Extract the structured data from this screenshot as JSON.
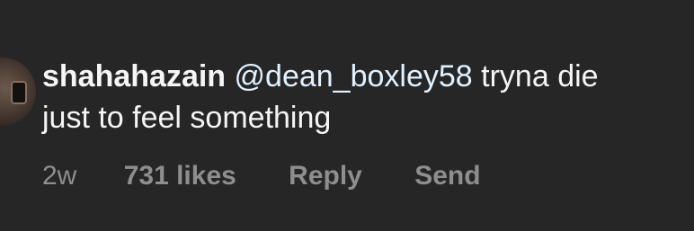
{
  "comment": {
    "username": "shahahazain",
    "mention": "@dean_boxley58",
    "text_line1": "tryna die",
    "text_line2": "just to feel something",
    "timestamp": "2w",
    "likes": "731 likes",
    "reply_label": "Reply",
    "send_label": "Send"
  },
  "colors": {
    "background": "#262626",
    "text": "#f5f5f5",
    "mention": "#e0f1ff",
    "meta": "#8e8e8e"
  }
}
